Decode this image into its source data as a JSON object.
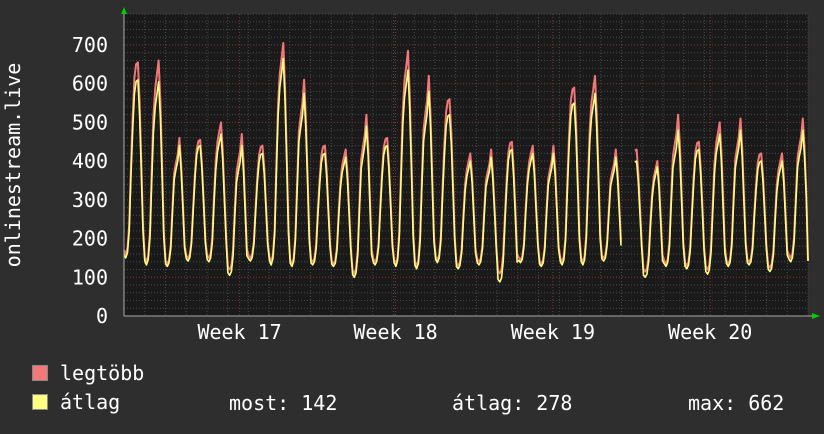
{
  "colors": {
    "background": "#2e2e2e",
    "plot_background": "#1a1a1a",
    "grid_minor": "#4a4a4a",
    "grid_major": "#7a3a3a",
    "axis_arrow": "#00cc00",
    "max_series": "#f07878",
    "avg_series": "#ffff80",
    "text": "#ffffff"
  },
  "chart_data": {
    "type": "line",
    "ylabel": "onlinestream.live",
    "ylim": [
      0,
      780
    ],
    "yticks": [
      0,
      100,
      200,
      300,
      400,
      500,
      600,
      700
    ],
    "x_tick_labels": [
      "Week 17",
      "Week 18",
      "Week 19",
      "Week 20"
    ],
    "days": 33,
    "points_per_day": 12,
    "grid": true,
    "series": [
      {
        "name": "legtöbb",
        "color": "#f07878",
        "daily_peaks": [
          655,
          660,
          460,
          455,
          500,
          470,
          440,
          705,
          610,
          440,
          430,
          520,
          460,
          685,
          620,
          560,
          420,
          430,
          450,
          440,
          440,
          590,
          620,
          430,
          430,
          400,
          520,
          450,
          500,
          510,
          420,
          420,
          510
        ],
        "daily_troughs": [
          160,
          140,
          135,
          150,
          150,
          120,
          150,
          140,
          135,
          140,
          135,
          110,
          140,
          135,
          130,
          145,
          130,
          140,
          110,
          145,
          135,
          140,
          140,
          150,
          140,
          115,
          135,
          130,
          120,
          135,
          140,
          125,
          150
        ]
      },
      {
        "name": "átlag",
        "color": "#ffff80",
        "daily_peaks": [
          610,
          605,
          440,
          440,
          470,
          440,
          420,
          665,
          575,
          420,
          410,
          490,
          440,
          635,
          580,
          520,
          400,
          410,
          430,
          420,
          420,
          550,
          575,
          410,
          400,
          385,
          480,
          430,
          470,
          480,
          400,
          400,
          480
        ],
        "daily_troughs": [
          150,
          132,
          128,
          142,
          140,
          105,
          142,
          132,
          128,
          132,
          128,
          100,
          132,
          128,
          122,
          138,
          122,
          132,
          88,
          138,
          128,
          132,
          132,
          142,
          132,
          100,
          128,
          122,
          108,
          128,
          132,
          115,
          140
        ]
      }
    ],
    "gap_days": [
      24
    ],
    "last_value": 142
  },
  "legend": {
    "max_label": "legtöbb",
    "avg_label": "átlag",
    "now_label": "most:",
    "now_value": "142",
    "avg_stat_label": "átlag:",
    "avg_stat_value": "278",
    "max_stat_label": "max:",
    "max_stat_value": "662"
  }
}
